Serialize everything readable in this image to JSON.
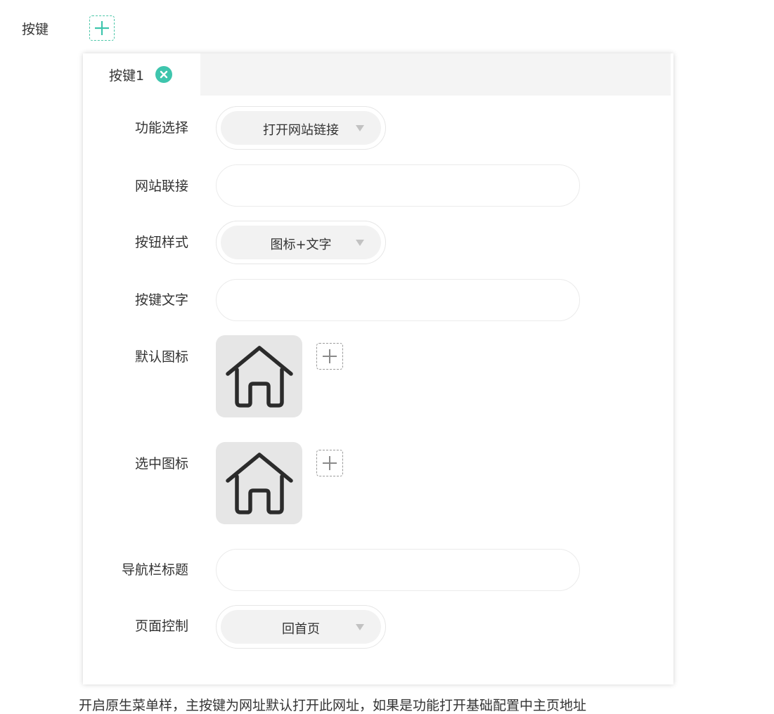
{
  "header": {
    "label": "按键"
  },
  "tabs": [
    {
      "label": "按键1"
    }
  ],
  "form": {
    "function": {
      "label": "功能选择",
      "value": "打开网站链接"
    },
    "website": {
      "label": "网站联接",
      "value": ""
    },
    "button_style": {
      "label": "按钮样式",
      "value": "图标+文字"
    },
    "button_text": {
      "label": "按键文字",
      "value": ""
    },
    "default_icon": {
      "label": "默认图标",
      "icon": "home-icon"
    },
    "selected_icon": {
      "label": "选中图标",
      "icon": "home-icon"
    },
    "nav_title": {
      "label": "导航栏标题",
      "value": ""
    },
    "page_control": {
      "label": "页面控制",
      "value": "回首页"
    }
  },
  "footer": {
    "text": "开启原生菜单样，主按键为网址默认打开此网址，如果是功能打开基础配置中主页地址"
  },
  "colors": {
    "accent": "#3ec5ad",
    "panel_shadow": "#d0d0d0",
    "select_bg": "#f2f2f2",
    "icon_bg": "#e6e6e6"
  }
}
